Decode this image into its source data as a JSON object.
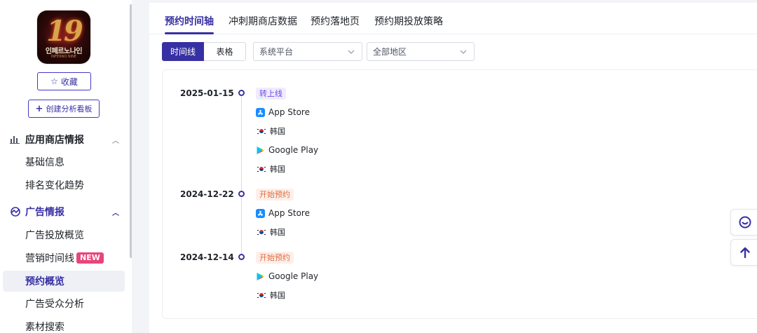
{
  "app": {
    "icon_title": "19",
    "icon_subtitle": "인페르노나인",
    "icon_tiny": "INFERNO NINE",
    "favorite_label": "收藏",
    "create_board_label": "创建分析看板"
  },
  "sidebar": {
    "section_store": "应用商店情报",
    "store_items": [
      "基础信息",
      "排名变化趋势"
    ],
    "section_ads": "广告情报",
    "ads_items": [
      "广告投放概览",
      "营销时间线",
      "预约概览",
      "广告受众分析",
      "素材搜索"
    ],
    "new_badge": "NEW"
  },
  "tabs": [
    "预约时间轴",
    "冲刺期商店数据",
    "预约落地页",
    "预约期投放策略"
  ],
  "toolbar": {
    "view_timeline": "时间线",
    "view_table": "表格",
    "platform_placeholder": "系统平台",
    "region_placeholder": "全部地区"
  },
  "timeline": [
    {
      "date": "2025-01-15",
      "tag": "转上线",
      "tag_color": "purple",
      "entries": [
        {
          "store": "App Store",
          "region": "韩国"
        },
        {
          "store": "Google Play",
          "region": "韩国"
        }
      ]
    },
    {
      "date": "2024-12-22",
      "tag": "开始预约",
      "tag_color": "orange",
      "entries": [
        {
          "store": "App Store",
          "region": "韩国"
        }
      ]
    },
    {
      "date": "2024-12-14",
      "tag": "开始预约",
      "tag_color": "orange",
      "entries": [
        {
          "store": "Google Play",
          "region": "韩国"
        }
      ]
    }
  ],
  "colors": {
    "accent": "#3730a3",
    "tag_purple_bg": "#efecfd",
    "tag_orange_bg": "#fdefe9",
    "new_badge": "#e8457a"
  }
}
